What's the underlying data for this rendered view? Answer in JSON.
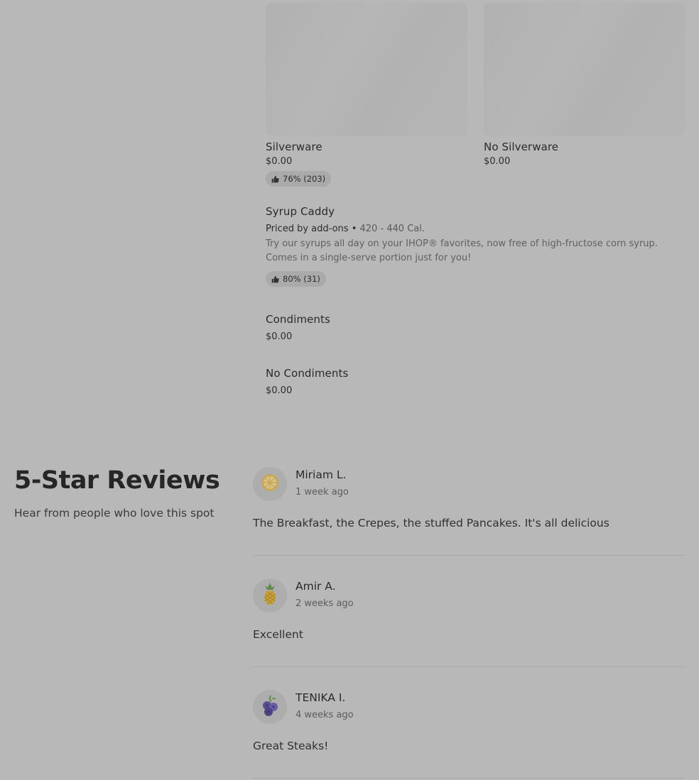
{
  "menu": {
    "grid_items": [
      {
        "title": "Silverware",
        "price": "$0.00",
        "rating": "76% (203)"
      },
      {
        "title": "No Silverware",
        "price": "$0.00"
      }
    ],
    "syrup": {
      "title": "Syrup Caddy",
      "priced": "Priced by add-ons",
      "separator": "•",
      "calories": "420 - 440 Cal.",
      "description": "Try our syrups all day on your IHOP® favorites, now free of high-fructose corn syrup. Comes in a single-serve portion just for you!",
      "rating": "80% (31)"
    },
    "condiments": {
      "title": "Condiments",
      "price": "$0.00"
    },
    "no_condiments": {
      "title": "No Condiments",
      "price": "$0.00"
    }
  },
  "reviews": {
    "title": "5-Star Reviews",
    "subtitle": "Hear from people who love this spot",
    "items": [
      {
        "name": "Miriam L.",
        "time": "1 week ago",
        "text": "The Breakfast, the Crepes, the stuffed Pancakes. It's all delicious",
        "avatar": "lemon-icon"
      },
      {
        "name": "Amir A.",
        "time": "2 weeks ago",
        "text": "Excellent",
        "avatar": "pineapple-icon"
      },
      {
        "name": "TENIKA I.",
        "time": "4 weeks ago",
        "text": "Great Steaks!",
        "avatar": "blueberries-icon"
      }
    ]
  },
  "colors": {
    "overlay_background": "#b8b8b8",
    "pill_background": "#aaaaaa"
  }
}
